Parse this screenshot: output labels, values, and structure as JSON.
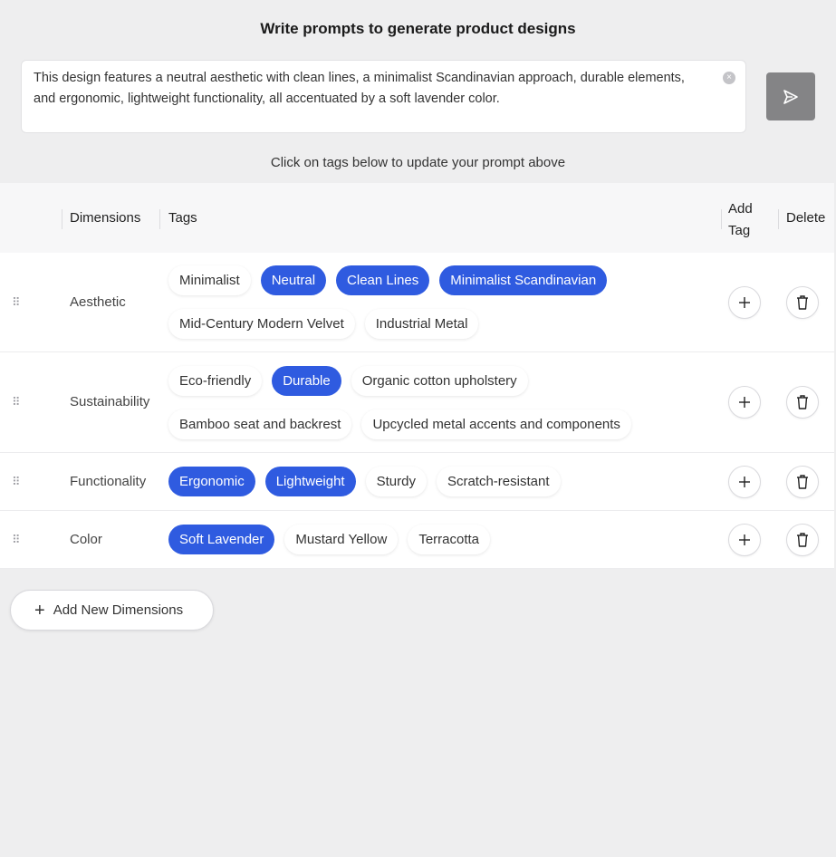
{
  "header": {
    "title": "Write prompts to generate product designs"
  },
  "prompt": {
    "text": "This design features a neutral aesthetic with clean lines, a minimalist Scandinavian approach, durable elements, and ergonomic, lightweight functionality, all accentuated by a soft lavender color."
  },
  "hint": "Click on tags below to update your prompt above",
  "table": {
    "headers": {
      "dimensions": "Dimensions",
      "tags": "Tags",
      "add_tag": "Add Tag",
      "delete": "Delete"
    },
    "rows": [
      {
        "dimension": "Aesthetic",
        "tags": [
          {
            "label": "Minimalist",
            "selected": false
          },
          {
            "label": "Neutral",
            "selected": true
          },
          {
            "label": "Clean Lines",
            "selected": true
          },
          {
            "label": "Minimalist Scandinavian",
            "selected": true
          },
          {
            "label": "Mid-Century Modern Velvet",
            "selected": false
          },
          {
            "label": "Industrial Metal",
            "selected": false
          }
        ]
      },
      {
        "dimension": "Sustainability",
        "tags": [
          {
            "label": "Eco-friendly",
            "selected": false
          },
          {
            "label": "Durable",
            "selected": true
          },
          {
            "label": "Organic cotton upholstery",
            "selected": false
          },
          {
            "label": "Bamboo seat and backrest",
            "selected": false
          },
          {
            "label": "Upcycled metal accents and components",
            "selected": false
          }
        ]
      },
      {
        "dimension": "Functionality",
        "tags": [
          {
            "label": "Ergonomic",
            "selected": true
          },
          {
            "label": "Lightweight",
            "selected": true
          },
          {
            "label": "Sturdy",
            "selected": false
          },
          {
            "label": "Scratch-resistant",
            "selected": false
          }
        ]
      },
      {
        "dimension": "Color",
        "tags": [
          {
            "label": "Soft Lavender",
            "selected": true
          },
          {
            "label": "Mustard Yellow",
            "selected": false
          },
          {
            "label": "Terracotta",
            "selected": false
          }
        ]
      }
    ]
  },
  "add_dimension_label": "Add New Dimensions",
  "colors": {
    "accent": "#2f5be0",
    "send_button": "#848486",
    "background": "#eeeeef"
  },
  "icons": {
    "drag": "drag-handle-icon",
    "plus": "plus-icon",
    "trash": "trash-icon",
    "send": "send-icon",
    "clear": "clear-icon"
  }
}
